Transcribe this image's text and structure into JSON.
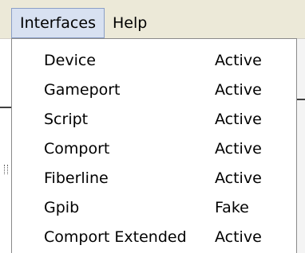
{
  "menubar": {
    "items": [
      {
        "label": "Interfaces"
      },
      {
        "label": "Help"
      }
    ]
  },
  "dropdown": {
    "items": [
      {
        "label": "Device",
        "status": "Active"
      },
      {
        "label": "Gameport",
        "status": "Active"
      },
      {
        "label": "Script",
        "status": "Active"
      },
      {
        "label": "Comport",
        "status": "Active"
      },
      {
        "label": "Fiberline",
        "status": "Active"
      },
      {
        "label": "Gpib",
        "status": "Fake"
      },
      {
        "label": "Comport Extended",
        "status": "Active"
      }
    ]
  }
}
